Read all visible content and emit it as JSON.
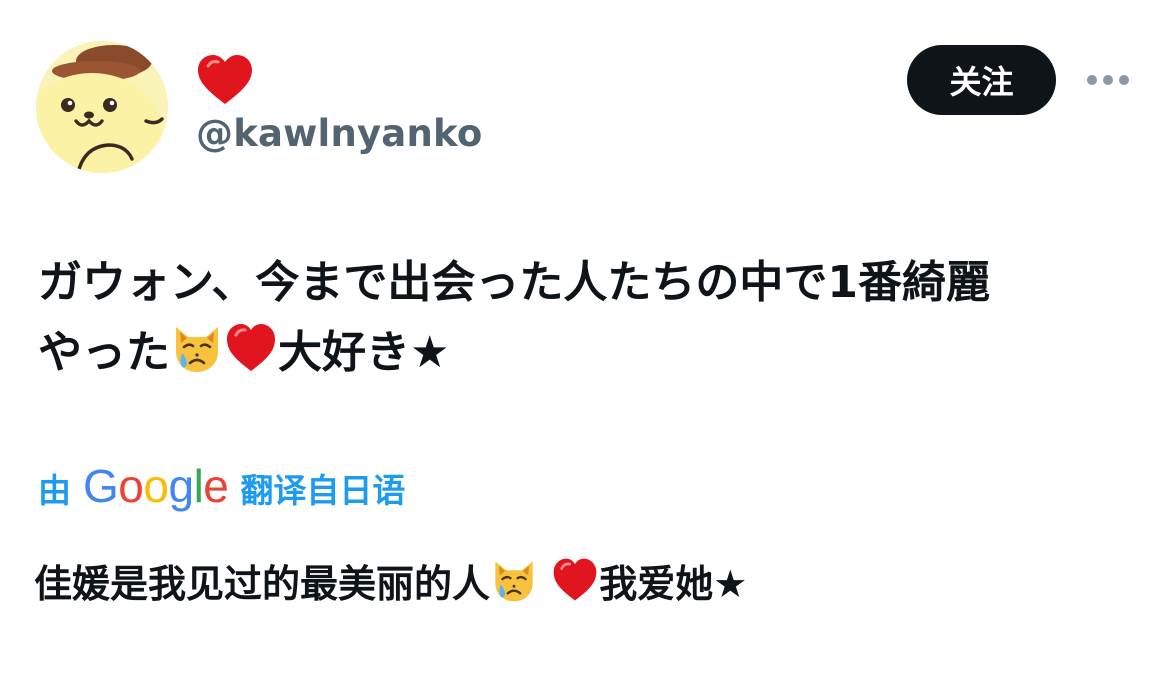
{
  "user": {
    "display_name_icon": "red-heart-icon",
    "handle": "@kawlnyanko",
    "avatar_icon": "pompompurin-avatar"
  },
  "actions": {
    "follow_label": "关注",
    "more_icon": "more-dots-icon"
  },
  "tweet": {
    "line1": "ガウォン、今まで出会った人たちの中で1番綺麗",
    "line2_start": "やった",
    "line2_end": "大好き★",
    "emojis": [
      "crying-cat-face-icon",
      "red-heart-icon"
    ]
  },
  "translation": {
    "prefix": "由",
    "brand": {
      "letters": [
        "G",
        "o",
        "o",
        "g",
        "l",
        "e"
      ],
      "colors": [
        "#4285F4",
        "#EA4335",
        "#FBBC05",
        "#4285F4",
        "#34A853",
        "#EA4335"
      ]
    },
    "suffix": "翻译自日语",
    "text_start": "佳媛是我见过的最美丽的人",
    "text_end": "我爱她★"
  },
  "colors": {
    "text": "#0f1419",
    "secondary_text": "#536471",
    "link": "#1d9bf0",
    "follow_bg": "#0f1419",
    "follow_text": "#ffffff",
    "heart": "#e0151e"
  }
}
